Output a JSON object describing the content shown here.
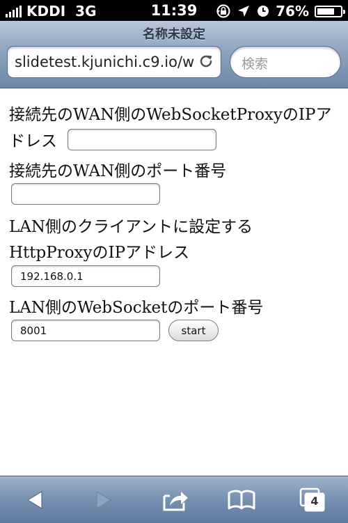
{
  "status_bar": {
    "carrier": "KDDI",
    "network": "3G",
    "time": "11:39",
    "battery_percent": "76%",
    "battery_level": 0.76,
    "icons": [
      "signal-bars-icon",
      "rotation-lock-icon",
      "location-arrow-icon",
      "alarm-clock-icon",
      "battery-icon"
    ]
  },
  "browser": {
    "page_title": "名称未設定",
    "url": "slidetest.kjunichi.c9.io/w",
    "search_placeholder": "検索",
    "tab_count": "4",
    "toolbar_icons": [
      "back-arrow-icon",
      "forward-arrow-icon",
      "share-icon",
      "bookmarks-icon",
      "tabs-icon"
    ]
  },
  "form": {
    "wan_ip_label_line1": "接続先のWAN側のWebSocketProxyのIPア",
    "wan_ip_label_line2": "ドレス",
    "wan_ip_value": "",
    "wan_port_label": "接続先のWAN側のポート番号",
    "wan_port_value": "",
    "lan_client_line1": "LAN側のクライアントに設定する",
    "lan_client_line2": "HttpProxyのIPアドレス",
    "lan_proxy_ip_value": "192.168.0.1",
    "lan_ws_port_label": "LAN側のWebSocketのポート番号",
    "lan_ws_port_value": "8001",
    "start_label": "start"
  }
}
